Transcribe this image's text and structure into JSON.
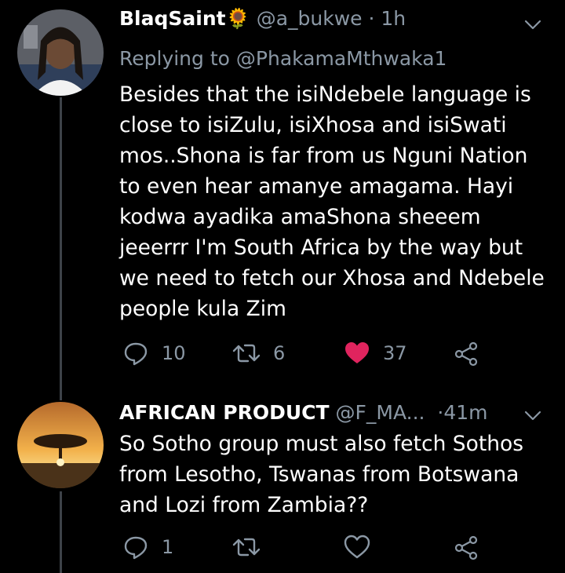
{
  "tweets": [
    {
      "name": "BlaqSaint",
      "emoji": "🌻",
      "handle": "@a_bukwe",
      "separator": "·",
      "time": "1h",
      "replying_label": "Replying to",
      "replying_handle": "@PhakamaMthwaka1",
      "text": "Besides that the isiNdebele language is\nclose to isiZulu, isiXhosa and isiSwati\nmos..Shona is far from us Nguni Nation\nto even hear amanye amagama. Hayi\nkodwa ayadika amaShona sheeem\njeeerrr I'm South Africa by the way but\nwe need to fetch our Xhosa and Ndebele\npeople kula Zim",
      "reply_count": "10",
      "retweet_count": "6",
      "like_count": "37",
      "liked": true
    },
    {
      "name": "AFRICAN PRODUCT",
      "handle": "@F_MA...",
      "separator": "·",
      "time": "41m",
      "text": "So Sotho group must also fetch Sothos\nfrom Lesotho, Tswanas from Botswana\nand Lozi from Zambia??",
      "reply_count": "1",
      "retweet_count": "",
      "like_count": "",
      "liked": false
    }
  ],
  "colors": {
    "background": "#000000",
    "text": "#ffffff",
    "muted": "#8b98a5",
    "like": "#e0245e",
    "thread_line": "#3d4249"
  },
  "icons": [
    "chevron-down-icon",
    "reply-icon",
    "retweet-icon",
    "heart-icon",
    "share-icon"
  ]
}
